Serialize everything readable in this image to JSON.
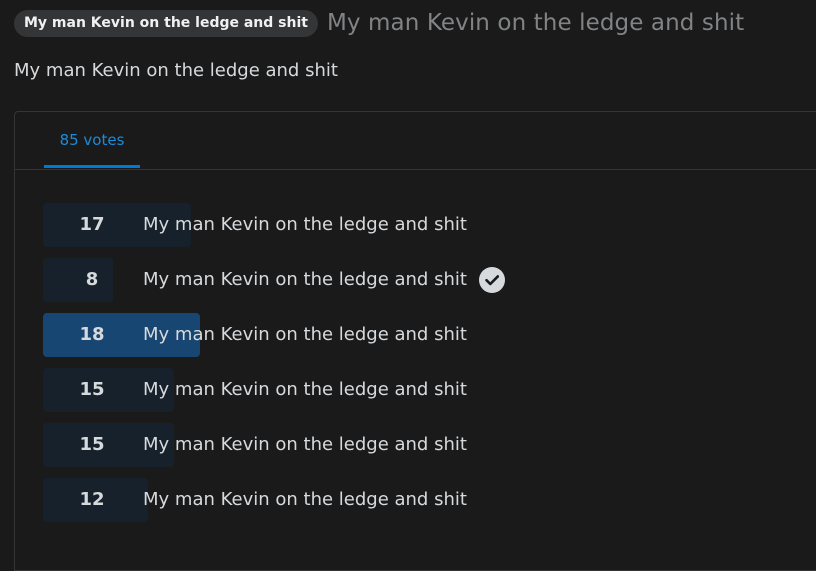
{
  "post": {
    "flair": "My man Kevin on the ledge and shit",
    "title": "My man Kevin on the ledge and shit",
    "body": "My man Kevin on the ledge and shit"
  },
  "poll": {
    "total_votes_label": "85 votes",
    "options": [
      {
        "votes": "17",
        "label": "My man Kevin on the ledge and shit",
        "user_choice": false,
        "winner": false
      },
      {
        "votes": "8",
        "label": "My man Kevin on the ledge and shit",
        "user_choice": true,
        "winner": false
      },
      {
        "votes": "18",
        "label": "My man Kevin on the ledge and shit",
        "user_choice": false,
        "winner": true
      },
      {
        "votes": "15",
        "label": "My man Kevin on the ledge and shit",
        "user_choice": false,
        "winner": false
      },
      {
        "votes": "15",
        "label": "My man Kevin on the ledge and shit",
        "user_choice": false,
        "winner": false
      },
      {
        "votes": "12",
        "label": "My man Kevin on the ledge and shit",
        "user_choice": false,
        "winner": false
      }
    ]
  },
  "colors": {
    "accent": "#0079d3",
    "winner_bar": "#174673",
    "bar": "#16212c",
    "background": "#1a1a1b"
  },
  "icons": {
    "selected_option": "checkmark-circle-icon"
  }
}
